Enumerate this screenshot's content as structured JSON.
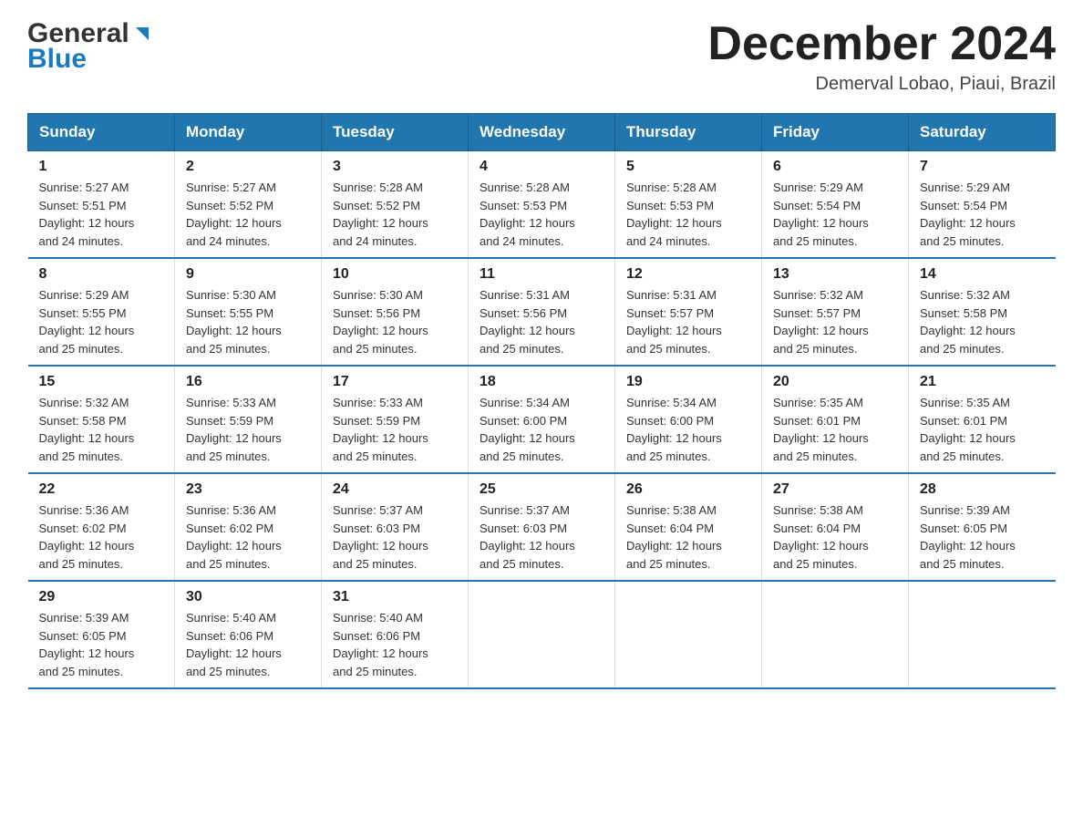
{
  "logo": {
    "general": "General",
    "blue": "Blue"
  },
  "title": "December 2024",
  "location": "Demerval Lobao, Piaui, Brazil",
  "days_of_week": [
    "Sunday",
    "Monday",
    "Tuesday",
    "Wednesday",
    "Thursday",
    "Friday",
    "Saturday"
  ],
  "weeks": [
    [
      {
        "day": "1",
        "sunrise": "5:27 AM",
        "sunset": "5:51 PM",
        "daylight": "12 hours and 24 minutes."
      },
      {
        "day": "2",
        "sunrise": "5:27 AM",
        "sunset": "5:52 PM",
        "daylight": "12 hours and 24 minutes."
      },
      {
        "day": "3",
        "sunrise": "5:28 AM",
        "sunset": "5:52 PM",
        "daylight": "12 hours and 24 minutes."
      },
      {
        "day": "4",
        "sunrise": "5:28 AM",
        "sunset": "5:53 PM",
        "daylight": "12 hours and 24 minutes."
      },
      {
        "day": "5",
        "sunrise": "5:28 AM",
        "sunset": "5:53 PM",
        "daylight": "12 hours and 24 minutes."
      },
      {
        "day": "6",
        "sunrise": "5:29 AM",
        "sunset": "5:54 PM",
        "daylight": "12 hours and 25 minutes."
      },
      {
        "day": "7",
        "sunrise": "5:29 AM",
        "sunset": "5:54 PM",
        "daylight": "12 hours and 25 minutes."
      }
    ],
    [
      {
        "day": "8",
        "sunrise": "5:29 AM",
        "sunset": "5:55 PM",
        "daylight": "12 hours and 25 minutes."
      },
      {
        "day": "9",
        "sunrise": "5:30 AM",
        "sunset": "5:55 PM",
        "daylight": "12 hours and 25 minutes."
      },
      {
        "day": "10",
        "sunrise": "5:30 AM",
        "sunset": "5:56 PM",
        "daylight": "12 hours and 25 minutes."
      },
      {
        "day": "11",
        "sunrise": "5:31 AM",
        "sunset": "5:56 PM",
        "daylight": "12 hours and 25 minutes."
      },
      {
        "day": "12",
        "sunrise": "5:31 AM",
        "sunset": "5:57 PM",
        "daylight": "12 hours and 25 minutes."
      },
      {
        "day": "13",
        "sunrise": "5:32 AM",
        "sunset": "5:57 PM",
        "daylight": "12 hours and 25 minutes."
      },
      {
        "day": "14",
        "sunrise": "5:32 AM",
        "sunset": "5:58 PM",
        "daylight": "12 hours and 25 minutes."
      }
    ],
    [
      {
        "day": "15",
        "sunrise": "5:32 AM",
        "sunset": "5:58 PM",
        "daylight": "12 hours and 25 minutes."
      },
      {
        "day": "16",
        "sunrise": "5:33 AM",
        "sunset": "5:59 PM",
        "daylight": "12 hours and 25 minutes."
      },
      {
        "day": "17",
        "sunrise": "5:33 AM",
        "sunset": "5:59 PM",
        "daylight": "12 hours and 25 minutes."
      },
      {
        "day": "18",
        "sunrise": "5:34 AM",
        "sunset": "6:00 PM",
        "daylight": "12 hours and 25 minutes."
      },
      {
        "day": "19",
        "sunrise": "5:34 AM",
        "sunset": "6:00 PM",
        "daylight": "12 hours and 25 minutes."
      },
      {
        "day": "20",
        "sunrise": "5:35 AM",
        "sunset": "6:01 PM",
        "daylight": "12 hours and 25 minutes."
      },
      {
        "day": "21",
        "sunrise": "5:35 AM",
        "sunset": "6:01 PM",
        "daylight": "12 hours and 25 minutes."
      }
    ],
    [
      {
        "day": "22",
        "sunrise": "5:36 AM",
        "sunset": "6:02 PM",
        "daylight": "12 hours and 25 minutes."
      },
      {
        "day": "23",
        "sunrise": "5:36 AM",
        "sunset": "6:02 PM",
        "daylight": "12 hours and 25 minutes."
      },
      {
        "day": "24",
        "sunrise": "5:37 AM",
        "sunset": "6:03 PM",
        "daylight": "12 hours and 25 minutes."
      },
      {
        "day": "25",
        "sunrise": "5:37 AM",
        "sunset": "6:03 PM",
        "daylight": "12 hours and 25 minutes."
      },
      {
        "day": "26",
        "sunrise": "5:38 AM",
        "sunset": "6:04 PM",
        "daylight": "12 hours and 25 minutes."
      },
      {
        "day": "27",
        "sunrise": "5:38 AM",
        "sunset": "6:04 PM",
        "daylight": "12 hours and 25 minutes."
      },
      {
        "day": "28",
        "sunrise": "5:39 AM",
        "sunset": "6:05 PM",
        "daylight": "12 hours and 25 minutes."
      }
    ],
    [
      {
        "day": "29",
        "sunrise": "5:39 AM",
        "sunset": "6:05 PM",
        "daylight": "12 hours and 25 minutes."
      },
      {
        "day": "30",
        "sunrise": "5:40 AM",
        "sunset": "6:06 PM",
        "daylight": "12 hours and 25 minutes."
      },
      {
        "day": "31",
        "sunrise": "5:40 AM",
        "sunset": "6:06 PM",
        "daylight": "12 hours and 25 minutes."
      },
      null,
      null,
      null,
      null
    ]
  ],
  "labels": {
    "sunrise": "Sunrise:",
    "sunset": "Sunset:",
    "daylight": "Daylight:"
  }
}
